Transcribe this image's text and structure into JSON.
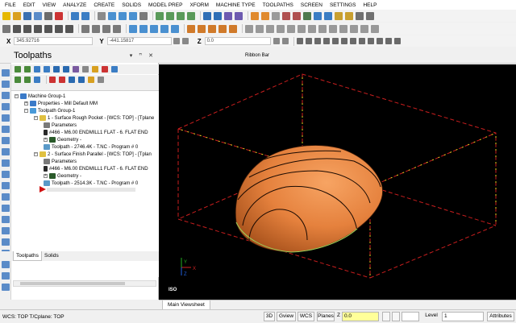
{
  "menu": [
    "FILE",
    "EDIT",
    "VIEW",
    "ANALYZE",
    "CREATE",
    "SOLIDS",
    "MODEL PREP",
    "XFORM",
    "MACHINE TYPE",
    "TOOLPATHS",
    "SCREEN",
    "SETTINGS",
    "HELP"
  ],
  "coords": {
    "x_label": "X",
    "x_value": "345.92716",
    "y_label": "Y",
    "y_value": "-441.15817",
    "z_label": "Z",
    "z_value": "0.0"
  },
  "ribbon_label": "Ribbon Bar",
  "panel": {
    "title": "Toolpaths",
    "controls": "▾ ꟸ ✕",
    "tree": [
      {
        "label": "Machine Group-1",
        "indent": 0,
        "icon": "machine-group-icon"
      },
      {
        "label": "Properties - Mill Default MM",
        "indent": 1,
        "icon": "properties-icon"
      },
      {
        "label": "Toolpath Group-1",
        "indent": 1,
        "icon": "toolpath-group-icon"
      },
      {
        "label": "1 - Surface Rough Pocket - [WCS: TOP] - [Tplane",
        "indent": 2,
        "icon": "operation-icon"
      },
      {
        "label": "Parameters",
        "indent": 3,
        "icon": "parameters-icon"
      },
      {
        "label": "#466 - M6.00 ENDMILL1 FLAT - 6. FLAT END",
        "indent": 3,
        "icon": "tool-icon"
      },
      {
        "label": "Geometry -",
        "indent": 3,
        "icon": "geometry-icon"
      },
      {
        "label": "Toolpath - 2746.4K - T.NC - Program # 0",
        "indent": 3,
        "icon": "toolpath-file-icon"
      },
      {
        "label": "2 - Surface Finish Parallel - [WCS: TOP] - [Tplan",
        "indent": 2,
        "icon": "operation-icon"
      },
      {
        "label": "Parameters",
        "indent": 3,
        "icon": "parameters-icon"
      },
      {
        "label": "#466 - M6.00 ENDMILL1 FLAT - 6. FLAT END",
        "indent": 3,
        "icon": "tool-icon"
      },
      {
        "label": "Geometry -",
        "indent": 3,
        "icon": "geometry-icon"
      },
      {
        "label": "Toolpath - 2514.3K - T.NC - Program # 0",
        "indent": 3,
        "icon": "toolpath-file-icon"
      }
    ],
    "tabs": [
      "Toolpaths",
      "Solids"
    ]
  },
  "viewport": {
    "view_label": "ISO",
    "axis_x": "X",
    "axis_y": "Y",
    "axis_z": "Z",
    "tab": "Main Viewsheet"
  },
  "status": {
    "text": "WCS: TOP  T/Cplane: TOP",
    "btn_3d": "3D",
    "btn_gview": "Gview",
    "btn_wcs": "WCS",
    "btn_planes": "Planes",
    "z_label": "Z",
    "z_value": "0.0",
    "level_label": "Level",
    "level_value": "1",
    "attributes": "Attributes"
  },
  "colors": {
    "part": "#e5813d",
    "stock_red": "#c81e1e",
    "stock_yellow": "#e8d21e",
    "z_highlight": "#ffff99",
    "accent": "#2b6fb6"
  }
}
